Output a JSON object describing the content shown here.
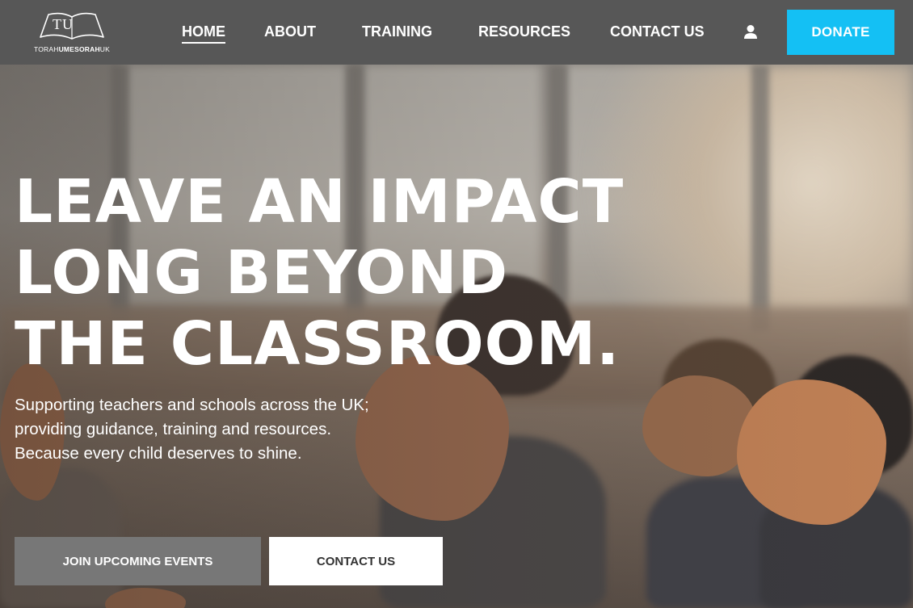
{
  "header": {
    "logo": {
      "mark": "TU",
      "text_light": "TORAH",
      "text_bold": "UMESORAH",
      "text_suffix": "UK"
    },
    "nav": [
      {
        "label": "HOME",
        "active": true
      },
      {
        "label": "ABOUT"
      },
      {
        "label": "TRAINING"
      },
      {
        "label": "RESOURCES"
      },
      {
        "label": "CONTACT US"
      }
    ],
    "user_icon": "user-icon",
    "donate_label": "DONATE",
    "donate_color": "#14c0f4",
    "bar_color": "#575757"
  },
  "hero": {
    "headline": [
      "LEAVE AN IMPACT",
      "LONG BEYOND",
      "THE CLASSROOM."
    ],
    "subtext": [
      "Supporting teachers and schools across the UK;",
      "providing guidance, training and resources.",
      "Because every child deserves to shine."
    ],
    "buttons": {
      "events": "JOIN UPCOMING EVENTS",
      "contact": "CONTACT US"
    }
  }
}
